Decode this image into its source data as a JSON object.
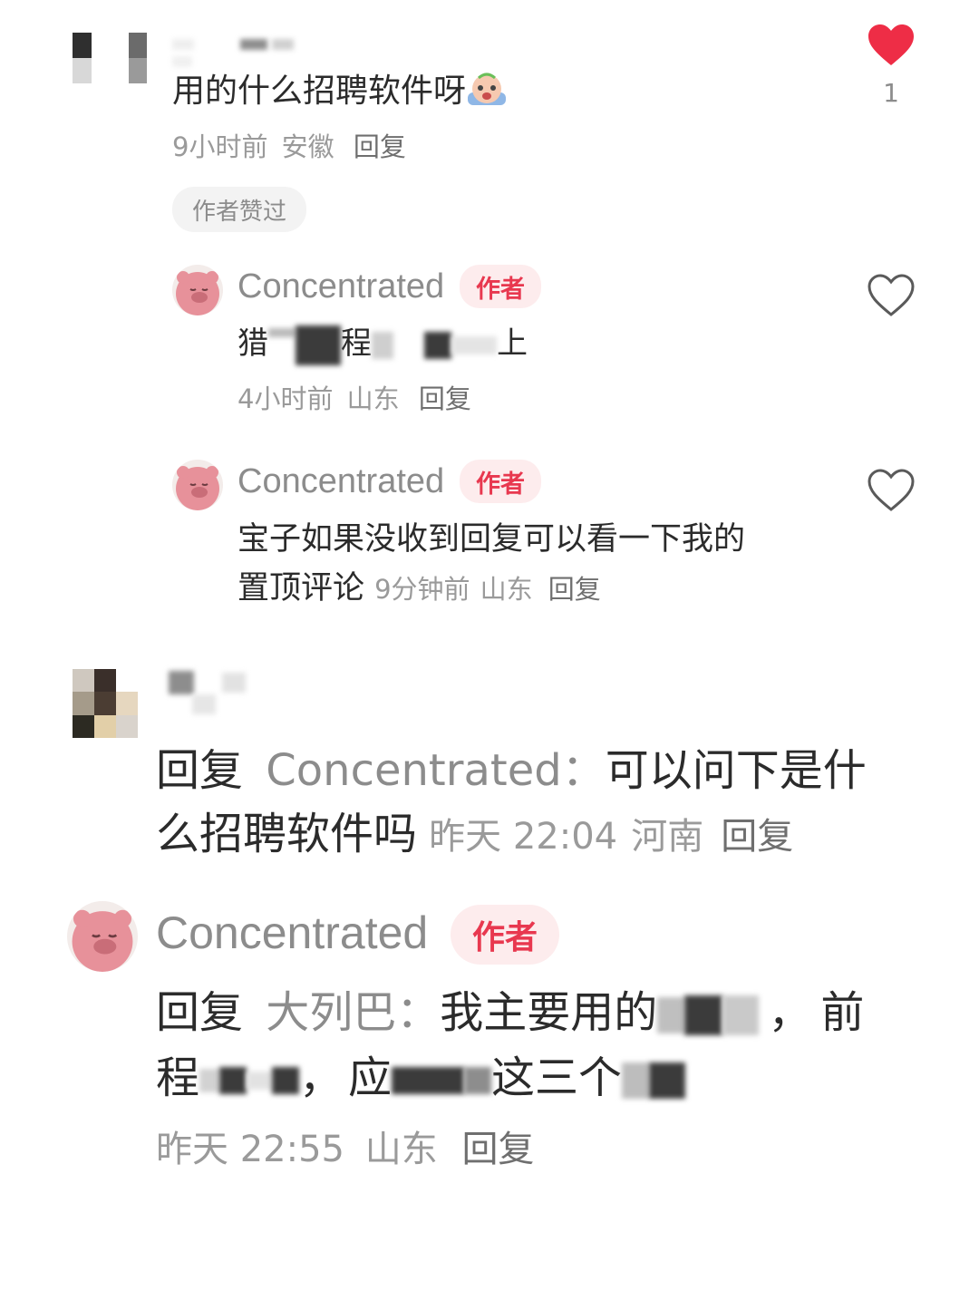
{
  "comment1": {
    "text": "用的什么招聘软件呀",
    "emoji": "crying-face-emoji",
    "time": "9小时前",
    "location": "安徽",
    "reply_label": "回复",
    "liked_badge": "作者赞过",
    "like_count": "1",
    "liked": true,
    "like_color": "#ee2d46"
  },
  "reply1": {
    "name": "Concentrated",
    "author_tag": "作者",
    "text_visible_start": "猎",
    "text_visible_mid": "程",
    "text_visible_end": "上",
    "time": "4小时前",
    "location": "山东",
    "reply_label": "回复"
  },
  "reply2": {
    "name": "Concentrated",
    "author_tag": "作者",
    "text_line1": "宝子如果没收到回复可以看一下我的",
    "text_line2": "置顶评论",
    "time": "9分钟前",
    "location": "山东",
    "reply_label": "回复"
  },
  "comment2": {
    "reply_prefix": "回复",
    "reply_to": "Concentrated：",
    "text_line1": "可以问下是什",
    "text_line2": "么招聘软件吗",
    "time": "昨天 22:04",
    "location": "河南",
    "reply_label": "回复"
  },
  "comment3": {
    "name": "Concentrated",
    "author_tag": "作者",
    "reply_prefix": "回复",
    "reply_to": "大列巴：",
    "text_part1": "我主要用的",
    "text_part2": "前",
    "text_part3": "程",
    "text_part4": "应",
    "text_part5": "这三个",
    "time": "昨天 22:55",
    "location": "山东",
    "reply_label": "回复"
  },
  "colors": {
    "author_tag_bg": "#fdeced",
    "author_tag_text": "#e8384f",
    "bear_pink": "#e7919a"
  }
}
